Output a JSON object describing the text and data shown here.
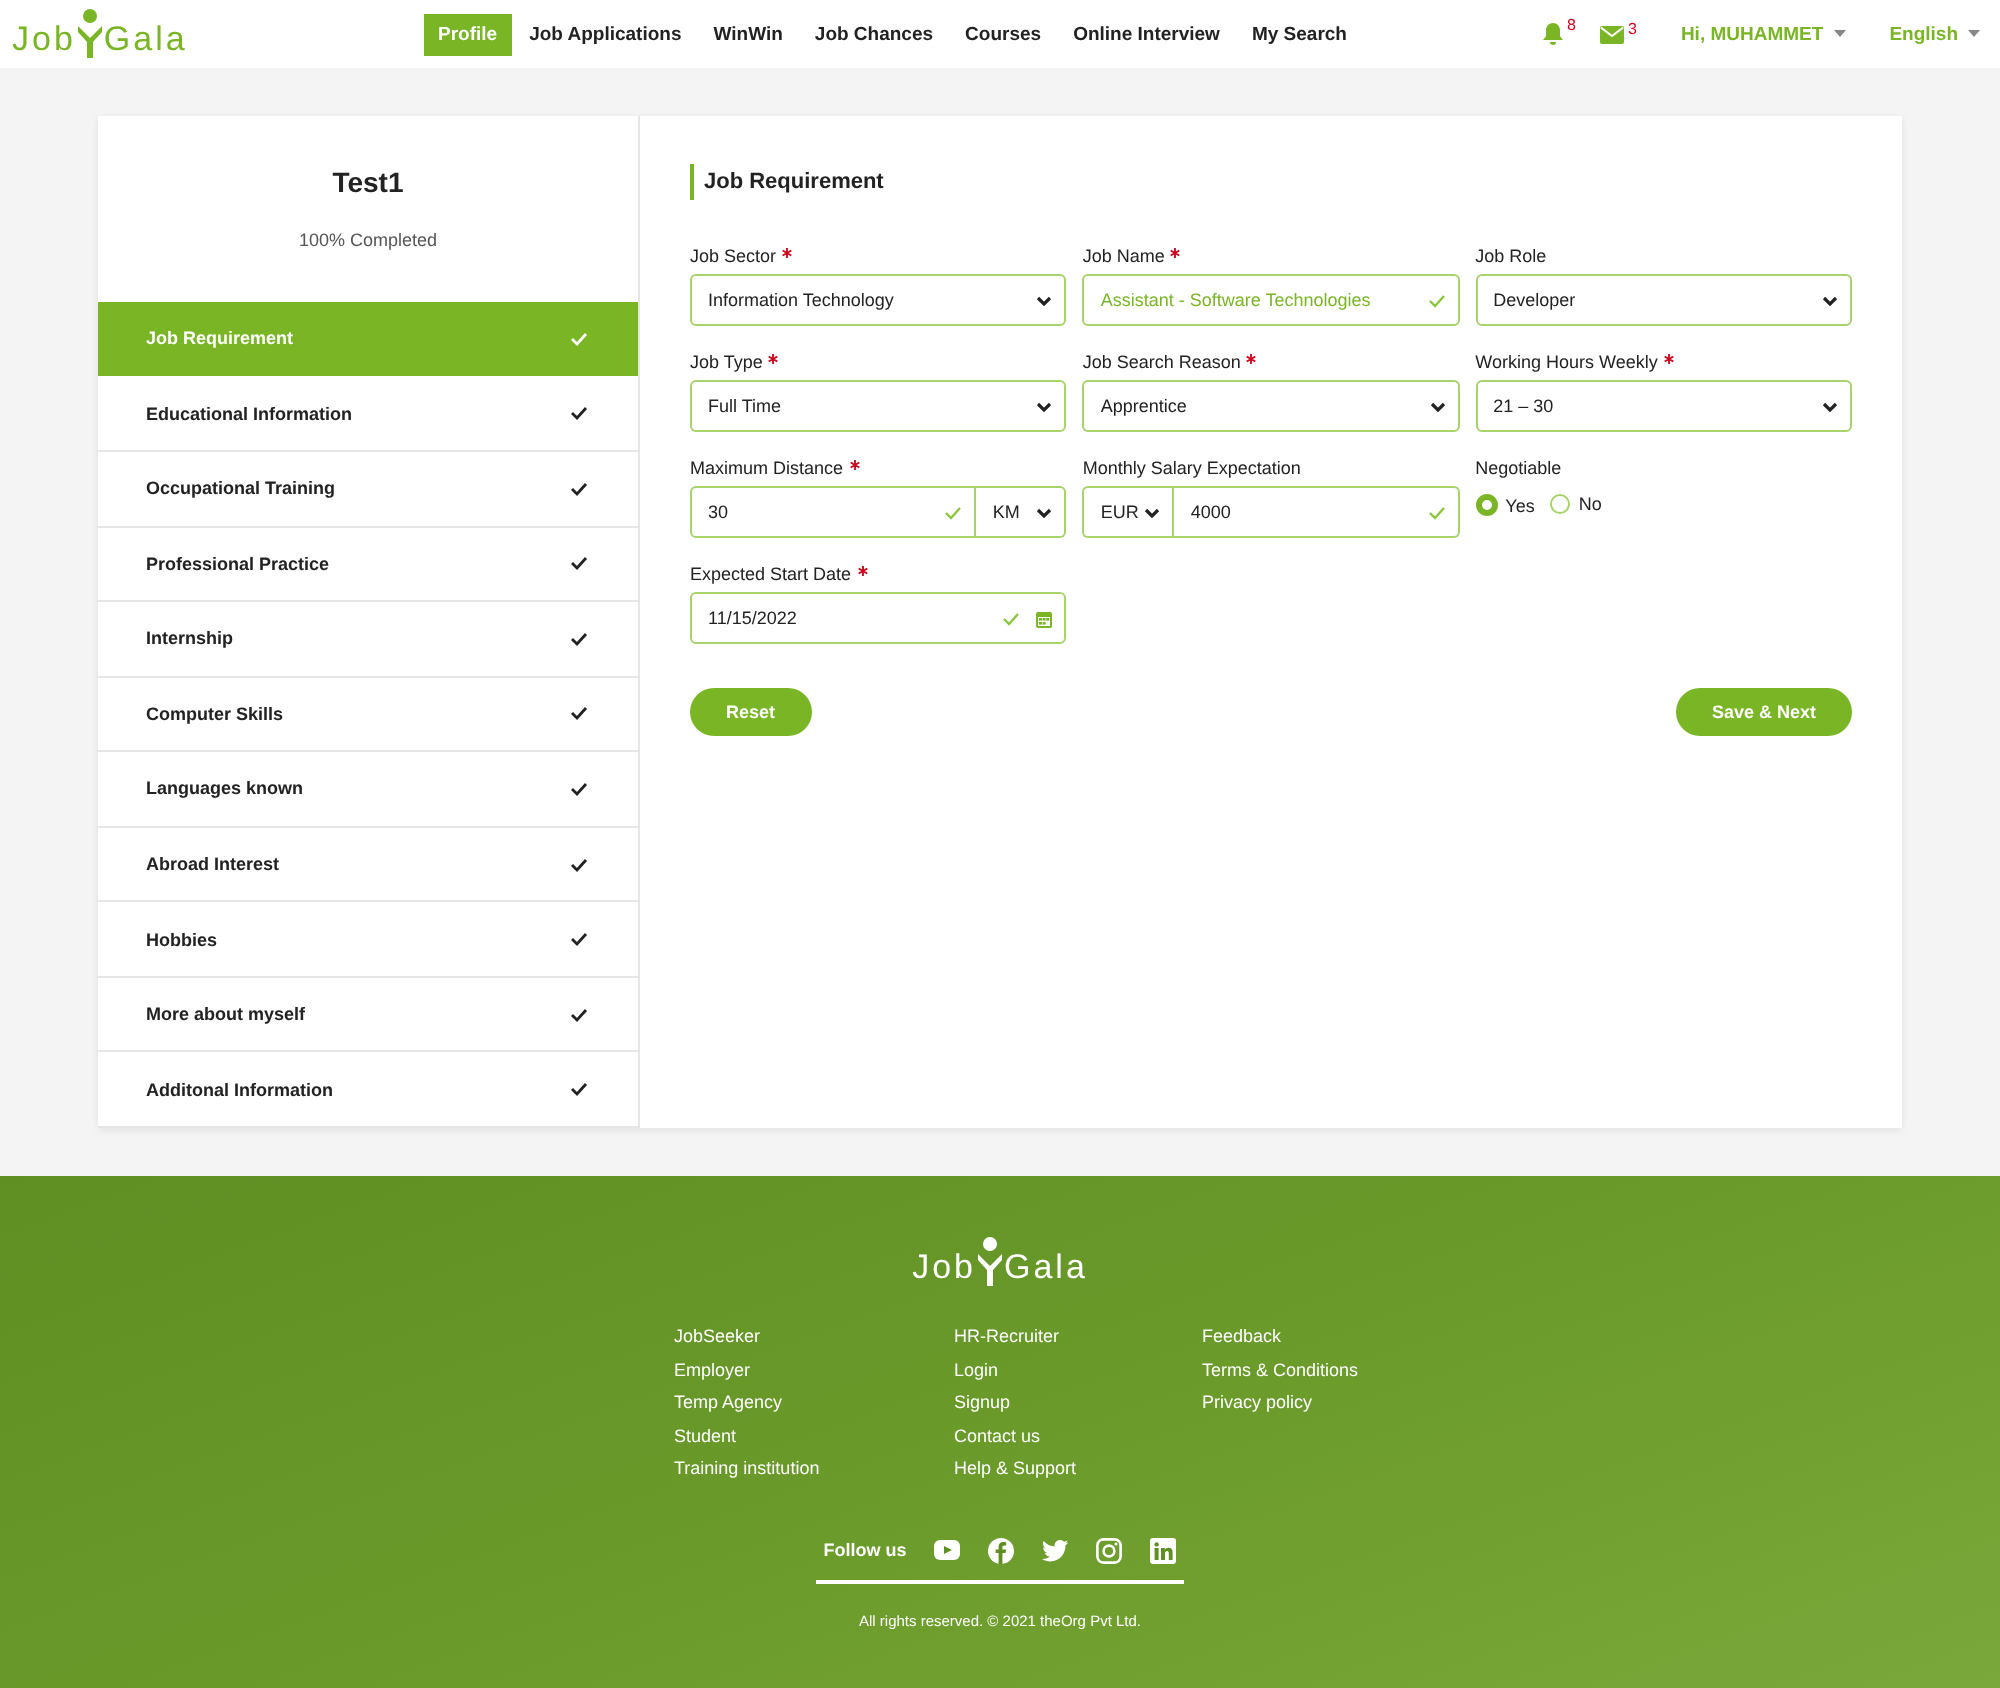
{
  "header": {
    "logo": {
      "left": "Job",
      "right": "Gala"
    },
    "nav": [
      {
        "label": "Profile",
        "selected": true
      },
      {
        "label": "Job Applications",
        "selected": false
      },
      {
        "label": "WinWin",
        "selected": false
      },
      {
        "label": "Job Chances",
        "selected": false
      },
      {
        "label": "Courses",
        "selected": false
      },
      {
        "label": "Online Interview",
        "selected": false
      },
      {
        "label": "My Search",
        "selected": false
      }
    ],
    "notifications": "8",
    "messages": "3",
    "user": "Hi, MUHAMMET",
    "language": "English"
  },
  "sidebar": {
    "title": "Test1",
    "progress": "100% Completed",
    "items": [
      {
        "label": "Job Requirement",
        "selected": true,
        "done": true
      },
      {
        "label": "Educational Information",
        "selected": false,
        "done": true
      },
      {
        "label": "Occupational Training",
        "selected": false,
        "done": true
      },
      {
        "label": "Professional Practice",
        "selected": false,
        "done": true
      },
      {
        "label": "Internship",
        "selected": false,
        "done": true
      },
      {
        "label": "Computer Skills",
        "selected": false,
        "done": true
      },
      {
        "label": "Languages known",
        "selected": false,
        "done": true
      },
      {
        "label": "Abroad Interest",
        "selected": false,
        "done": true
      },
      {
        "label": "Hobbies",
        "selected": false,
        "done": true
      },
      {
        "label": "More about myself",
        "selected": false,
        "done": true
      },
      {
        "label": "Additonal Information",
        "selected": false,
        "done": true
      }
    ]
  },
  "form": {
    "title": "Job Requirement",
    "fields": [
      {
        "kind": "select",
        "label": "Job Sector",
        "required": true,
        "value": "Information Technology"
      },
      {
        "kind": "picked",
        "label": "Job Name",
        "required": true,
        "value": "Assistant - Software Technologies"
      },
      {
        "kind": "select",
        "label": "Job Role",
        "required": false,
        "value": "Developer"
      },
      {
        "kind": "select",
        "label": "Job Type",
        "required": true,
        "value": "Full Time"
      },
      {
        "kind": "select",
        "label": "Job Search Reason",
        "required": true,
        "value": "Apprentice"
      },
      {
        "kind": "select",
        "label": "Working Hours Weekly",
        "required": true,
        "value": "21 – 30"
      },
      {
        "kind": "number-unit",
        "label": "Maximum Distance",
        "required": true,
        "value": "30",
        "unit": "KM"
      },
      {
        "kind": "unit-number",
        "label": "Monthly Salary Expectation",
        "required": false,
        "value": "4000",
        "unit": "EUR"
      },
      {
        "kind": "radio",
        "label": "Negotiable",
        "required": false,
        "options": [
          {
            "label": "Yes",
            "selected": true
          },
          {
            "label": "No",
            "selected": false
          }
        ]
      },
      {
        "kind": "date",
        "label": "Expected Start Date",
        "required": true,
        "value": "11/15/2022"
      }
    ],
    "reset": "Reset",
    "submit": "Save & Next"
  },
  "footer": {
    "logo": {
      "left": "Job",
      "right": "Gala"
    },
    "columns": [
      [
        "JobSeeker",
        "Employer",
        "Temp Agency",
        "Student",
        "Training institution"
      ],
      [
        "HR-Recruiter",
        "Login",
        "Signup",
        "Contact us",
        "Help & Support"
      ],
      [
        "Feedback",
        "Terms & Conditions",
        "Privacy policy"
      ]
    ],
    "follow": "Follow us",
    "copyright": "All rights reserved. © 2021 theOrg Pvt Ltd."
  }
}
